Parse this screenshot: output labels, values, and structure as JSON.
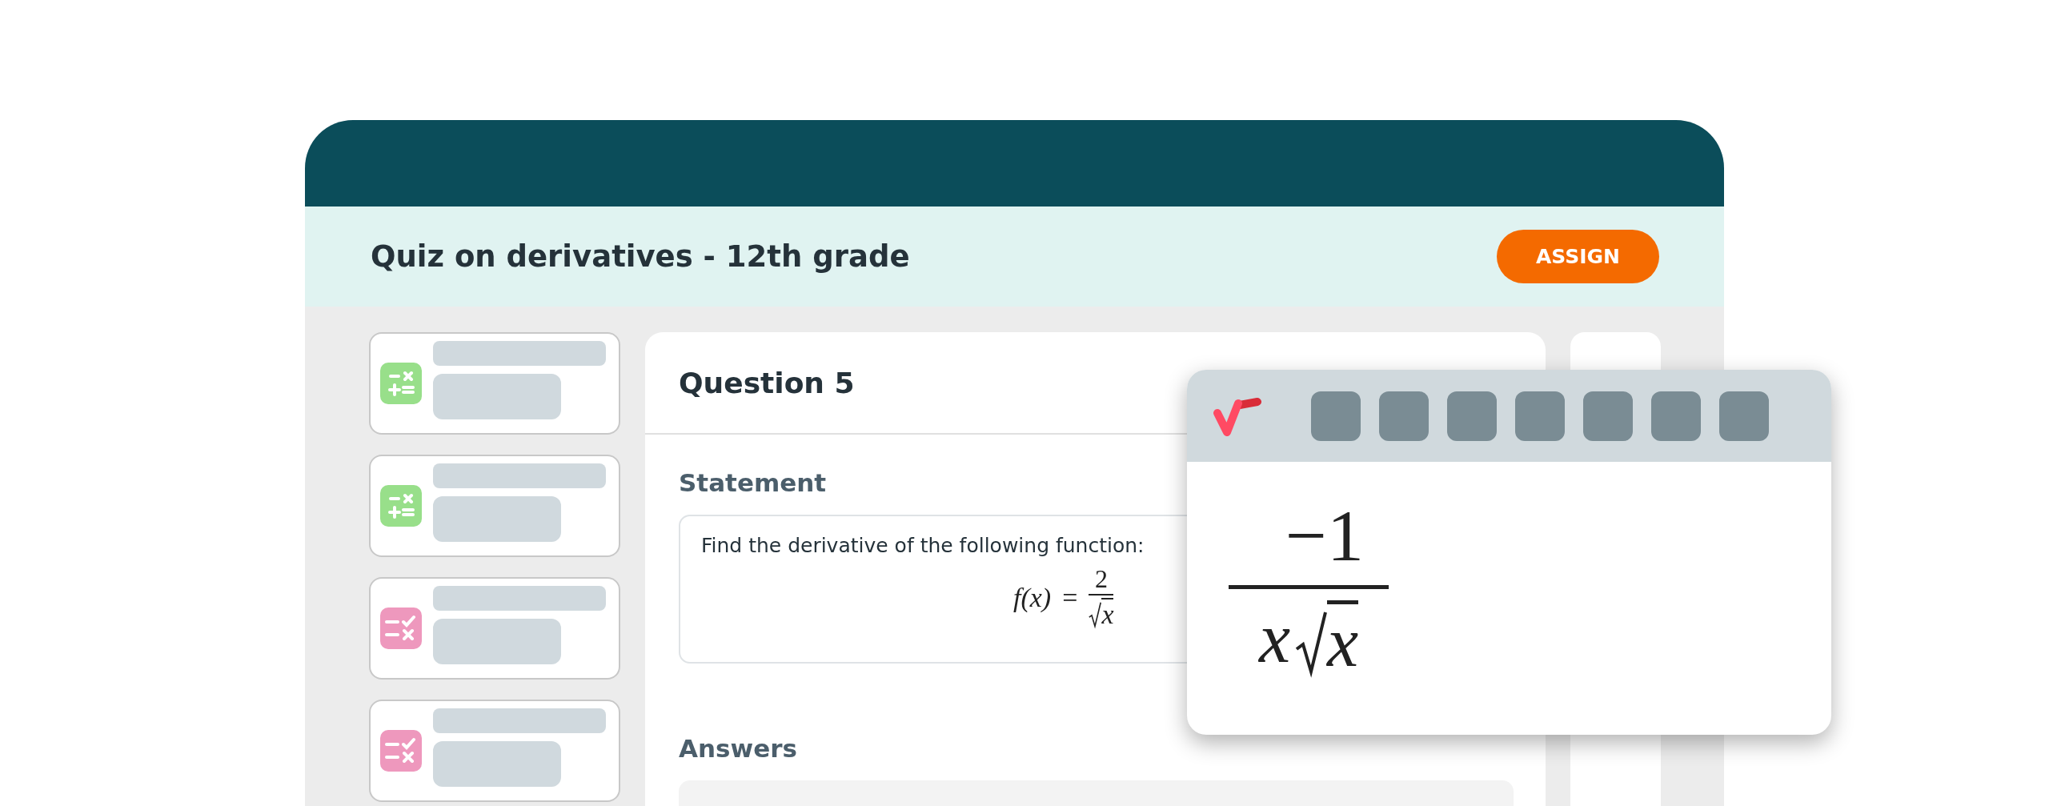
{
  "header": {
    "title": "Quiz on derivatives - 12th grade",
    "assign_button": "ASSIGN"
  },
  "question_cards": [
    {
      "kind": "operations"
    },
    {
      "kind": "operations"
    },
    {
      "kind": "checklist"
    },
    {
      "kind": "checklist"
    }
  ],
  "question": {
    "title": "Question 5",
    "statement_label": "Statement",
    "statement_text": "Find the derivative of the following function:",
    "formula": {
      "lhs": "f(x)",
      "equals": "=",
      "numerator": "2",
      "radicand": "x"
    },
    "answers_label": "Answers"
  },
  "math_editor": {
    "numerator": "−1",
    "denominator_factor": "x",
    "radicand": "x"
  }
}
